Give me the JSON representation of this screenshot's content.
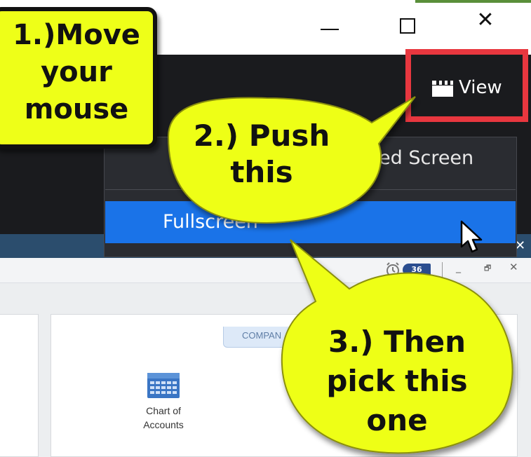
{
  "window": {
    "minimize_label": "—",
    "maximize_label": "□",
    "close_label": "✕"
  },
  "app": {
    "view_button": {
      "label": "View",
      "icon": "clapperboard-icon"
    },
    "view_menu": {
      "items": [
        {
          "label": "ed Screen"
        },
        {
          "label": "Fullscreen",
          "highlighted": true
        }
      ]
    },
    "navy_strip_close": "✕",
    "subtoolbar": {
      "reminder_icon": "alarm-clock-icon",
      "badge_count": "36",
      "minimize_label": "_",
      "restore_label": "🗗",
      "close_label": "✕"
    },
    "company_tab": "COMPAN",
    "chart_of_accounts": {
      "label_line1": "Chart of",
      "label_line2": "Accounts",
      "icon": "calculator-grid-icon"
    }
  },
  "callouts": {
    "step1": {
      "line1": "1.)Move",
      "line2": "your",
      "line3": "mouse"
    },
    "step2": {
      "line1": "2.) Push",
      "line2": "this"
    },
    "step3": {
      "line1": "3.) Then",
      "line2": "pick this",
      "line3": "one"
    }
  },
  "colors": {
    "callout_yellow": "#eeff18",
    "highlight_red": "#e8373f",
    "menu_blue": "#1a73e8",
    "dark_band": "#1a1b1e",
    "navy_strip": "#2b4d6d"
  }
}
